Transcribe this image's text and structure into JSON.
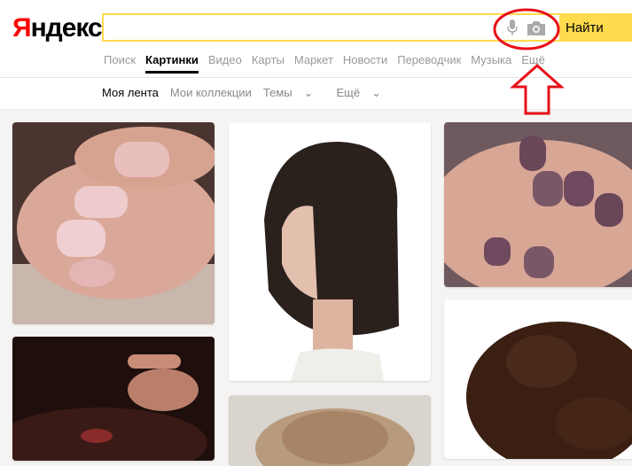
{
  "logo": {
    "first_letter": "Я",
    "rest": "ндекс"
  },
  "search": {
    "value": "",
    "placeholder": "",
    "button_label": "Найти"
  },
  "services": [
    {
      "label": "Поиск"
    },
    {
      "label": "Картинки"
    },
    {
      "label": "Видео"
    },
    {
      "label": "Карты"
    },
    {
      "label": "Маркет"
    },
    {
      "label": "Новости"
    },
    {
      "label": "Переводчик"
    },
    {
      "label": "Музыка"
    },
    {
      "label": "Ещё"
    }
  ],
  "subnav": {
    "feed": "Моя лента",
    "collections": "Мои коллекции",
    "themes": "Темы",
    "themes_arrow": "⌄",
    "more": "Ещё",
    "more_arrow": "⌄"
  },
  "colors": {
    "accent": "#ffdb4d",
    "brand_red": "#ff0000",
    "annotation_red": "#e8101a"
  },
  "icons": {
    "mic": "microphone-icon",
    "camera": "camera-icon"
  }
}
